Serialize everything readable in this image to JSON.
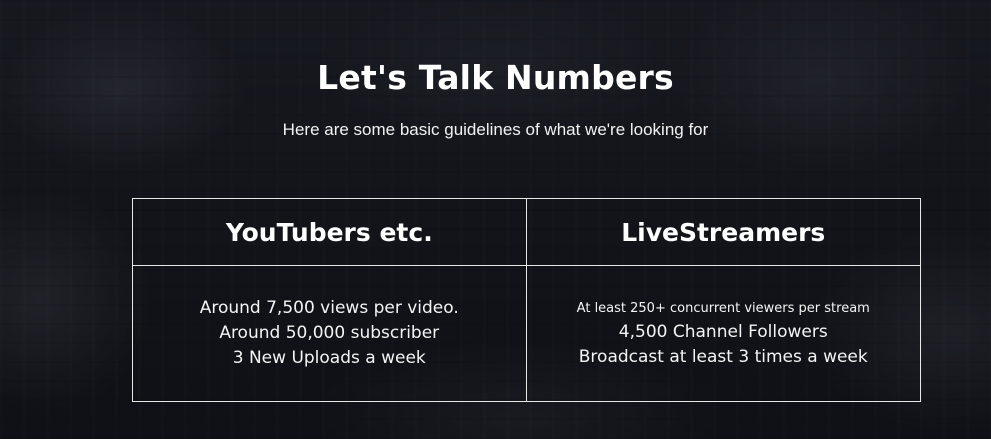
{
  "hero": {
    "title": "Let's Talk Numbers",
    "subtitle": "Here are some basic guidelines of what we're looking for"
  },
  "columns": [
    {
      "heading": "YouTubers etc.",
      "lines": [
        "Around 7,500 views per video.",
        "Around 50,000 subscriber",
        "3 New Uploads a week"
      ]
    },
    {
      "heading": "LiveStreamers",
      "lines": [
        "At least 250+ concurrent viewers per stream",
        "4,500 Channel Followers",
        "Broadcast at least 3 times a week"
      ]
    }
  ]
}
